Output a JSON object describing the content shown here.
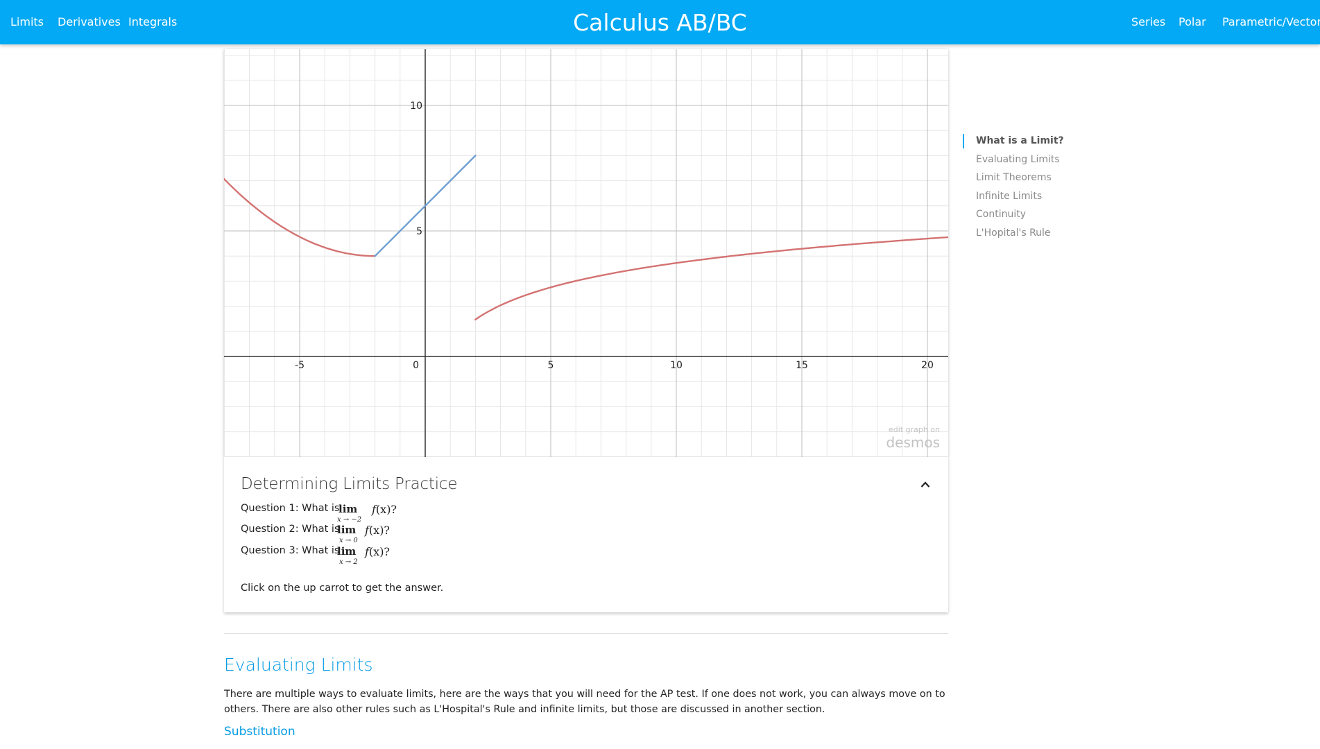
{
  "nav": {
    "left": [
      {
        "label": "Limits"
      },
      {
        "label": "Derivatives"
      },
      {
        "label": "Integrals"
      }
    ],
    "brand": "Calculus AB/BC",
    "right": [
      {
        "label": "Series"
      },
      {
        "label": "Polar"
      },
      {
        "label": "Parametric/Vectors"
      }
    ]
  },
  "graph": {
    "watermark_small": "edit graph on",
    "watermark_logo": "desmos",
    "x_ticks": [
      "-5",
      "0",
      "5",
      "10",
      "15",
      "20"
    ],
    "y_ticks": [
      "10",
      "5"
    ],
    "colors": {
      "red": "#d47272",
      "blue": "#6f9ed1",
      "grid": "#e6e6e6",
      "major_grid": "#bdbdbd",
      "axis": "#333333"
    }
  },
  "practice": {
    "title": "Determining Limits Practice",
    "questions": [
      {
        "label": "Question 1: What is",
        "limit_word": "lim",
        "sub": "x → −2",
        "expr_f": "f",
        "expr_rest": "(x)?"
      },
      {
        "label": "Question 2: What is",
        "limit_word": "lim",
        "sub": "x → 0",
        "expr_f": "f",
        "expr_rest": "(x)?"
      },
      {
        "label": "Question 3: What is",
        "limit_word": "lim",
        "sub": "x → 2",
        "expr_f": "f",
        "expr_rest": "(x)?"
      }
    ],
    "footer": "Click on the up carrot to get the answer."
  },
  "section": {
    "heading": "Evaluating Limits",
    "body": "There are multiple ways to evaluate limits, here are the ways that you will need for the AP test. If one does not work, you can always move on to others. There are also other rules such as L'Hospital's Rule and infinite limits, but those are discussed in another section.",
    "sub_heading": "Substitution"
  },
  "toc": [
    {
      "label": "What is a Limit?",
      "active": true
    },
    {
      "label": "Evaluating Limits",
      "active": false
    },
    {
      "label": "Limit Theorems",
      "active": false
    },
    {
      "label": "Infinite Limits",
      "active": false
    },
    {
      "label": "Continuity",
      "active": false
    },
    {
      "label": "L'Hopital's Rule",
      "active": false
    }
  ]
}
